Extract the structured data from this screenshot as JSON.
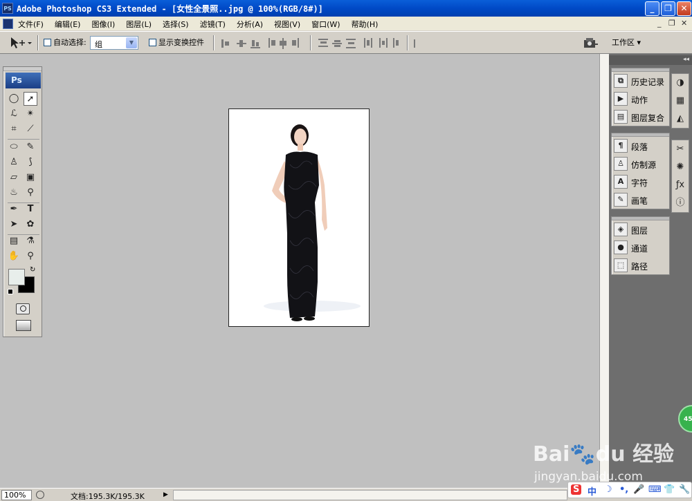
{
  "titlebar": {
    "app_icon": "PS",
    "title": "Adobe Photoshop CS3 Extended - [女性全景照..jpg @ 100%(RGB/8#)]",
    "minimize": "_",
    "maximize": "❐",
    "close": "✕"
  },
  "menubar": {
    "items": [
      "文件(F)",
      "编辑(E)",
      "图像(I)",
      "图层(L)",
      "选择(S)",
      "滤镜(T)",
      "分析(A)",
      "视图(V)",
      "窗口(W)",
      "帮助(H)"
    ],
    "doc_controls": [
      "_",
      "❐",
      "✕"
    ]
  },
  "options": {
    "auto_select_label": "自动选择:",
    "auto_select_value": "组",
    "show_transform_label": "显示变换控件",
    "workspace_label": "工作区 ▾"
  },
  "toolbox": {
    "logo": "Ps"
  },
  "panels": {
    "group1": [
      "历史记录",
      "动作",
      "图层复合"
    ],
    "group2": [
      "段落",
      "仿制源",
      "字符",
      "画笔"
    ],
    "group3": [
      "图层",
      "通道",
      "路径"
    ]
  },
  "statusbar": {
    "zoom": "100%",
    "doc_info": "文档:195.3K/195.3K"
  },
  "ime": {
    "s_label": "S",
    "zh_label": "中"
  },
  "badge": "45",
  "watermark": {
    "logo": "Bai",
    "logo_paw": "du",
    "brand": "经验",
    "url": "jingyan.baidu.com"
  },
  "colors": {
    "title_bar": "#0054e3",
    "workspace_bg": "#c0c0c0",
    "panel_dock": "#6e6e6e"
  }
}
